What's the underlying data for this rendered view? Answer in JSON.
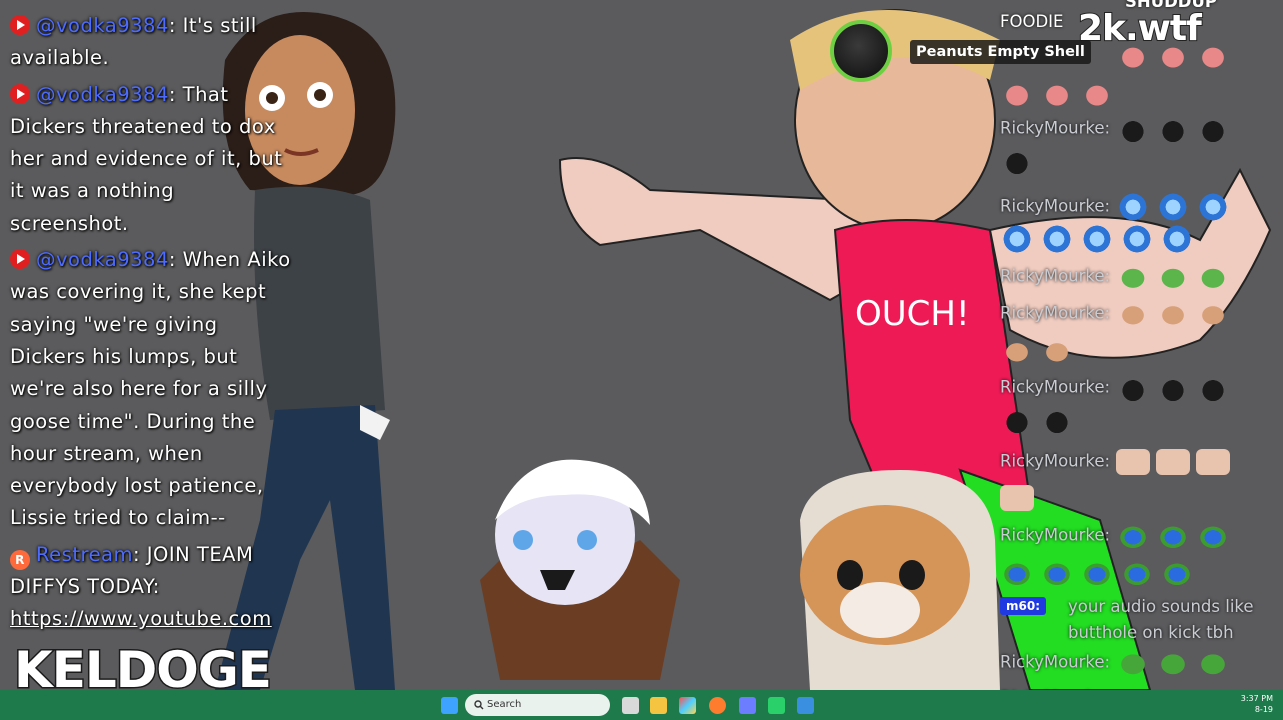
{
  "left_chat": {
    "messages": [
      {
        "platform": "youtube",
        "author": "@vodka9384",
        "text": "It's still available."
      },
      {
        "platform": "youtube",
        "author": "@vodka9384",
        "text": "That Dickers threatened to dox her and evidence of it, but it was a nothing screenshot."
      },
      {
        "platform": "youtube",
        "author": "@vodka9384",
        "text": "When Aiko was covering it, she kept saying \"we're giving Dickers his lumps, but we're also here for a silly goose time\". During the hour stream, when everybody lost patience, Lissie tried to claim--"
      },
      {
        "platform": "restream",
        "author": "Restream",
        "text": "JOIN TEAM DIFFYS TODAY:",
        "link": "https://www.youtube.com"
      }
    ]
  },
  "overlay": {
    "keldoge": "KELDOGE",
    "site": "2k.wtf",
    "ouch": "OUCH!"
  },
  "notification": {
    "name": "Peanuts Empty Shell"
  },
  "right_chat": {
    "top_partial": "SHUDDUP",
    "foodie": "FOODIE",
    "user": "RickyMourke:",
    "m60_badge": "m60:",
    "m60_text": "your audio sounds like butthole on kick tbh"
  },
  "taskbar": {
    "search_placeholder": "Search",
    "time": "3:37 PM",
    "date": "8-19"
  },
  "colors": {
    "yt_red": "#e02020",
    "author_blue": "#4d6bff",
    "taskbar": "#1e7a4a",
    "bg": "#5b5b5d"
  }
}
